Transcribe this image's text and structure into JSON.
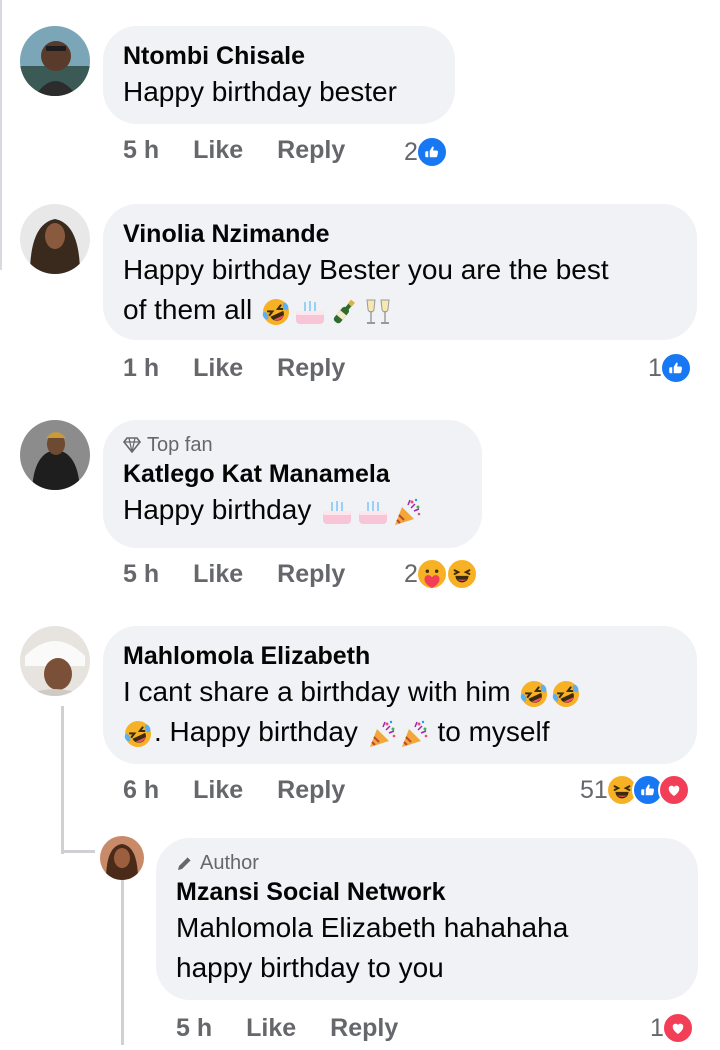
{
  "comments": [
    {
      "name": "Ntombi Chisale",
      "text": "Happy birthday bester",
      "time": "5 h",
      "like": "Like",
      "reply": "Reply",
      "reaction_count": "2",
      "reactions": [
        "like-icon"
      ]
    },
    {
      "name": "Vinolia Nzimande",
      "text_line1": "Happy birthday Bester you are the best",
      "text_line2": "of them all",
      "emojis": [
        "rolling-laughing-emoji",
        "birthday-cake-emoji",
        "champagne-emoji",
        "clinking-glasses-emoji"
      ],
      "time": "1 h",
      "like": "Like",
      "reply": "Reply",
      "reaction_count": "1",
      "reactions": [
        "like-icon"
      ]
    },
    {
      "badge": "Top fan",
      "name": "Katlego Kat Manamela",
      "text": "Happy birthday",
      "emojis": [
        "birthday-cake-emoji",
        "birthday-cake-emoji",
        "party-popper-emoji"
      ],
      "time": "5 h",
      "like": "Like",
      "reply": "Reply",
      "reaction_count": "2",
      "reactions": [
        "care-icon",
        "haha-icon"
      ]
    },
    {
      "name": "Mahlomola Elizabeth",
      "text_line1": "I cant share a birthday with him",
      "text_line2a": ". Happy birthday",
      "text_line2b": "to myself",
      "time": "6 h",
      "like": "Like",
      "reply": "Reply",
      "reaction_count": "51",
      "reactions": [
        "haha-icon",
        "like-icon",
        "love-icon"
      ]
    }
  ],
  "reply": {
    "badge": "Author",
    "name": "Mzansi Social Network",
    "text_line1": "Mahlomola Elizabeth hahahaha",
    "text_line2": "happy birthday to you",
    "time": "5 h",
    "like": "Like",
    "reply": "Reply",
    "reaction_count": "1",
    "reactions": [
      "love-icon"
    ]
  },
  "colors": {
    "bubble": "#f0f2f5",
    "meta": "#65676b",
    "like_blue": "#1877f2",
    "love_red": "#f33e58",
    "haha_yellow": "#f7b125"
  }
}
